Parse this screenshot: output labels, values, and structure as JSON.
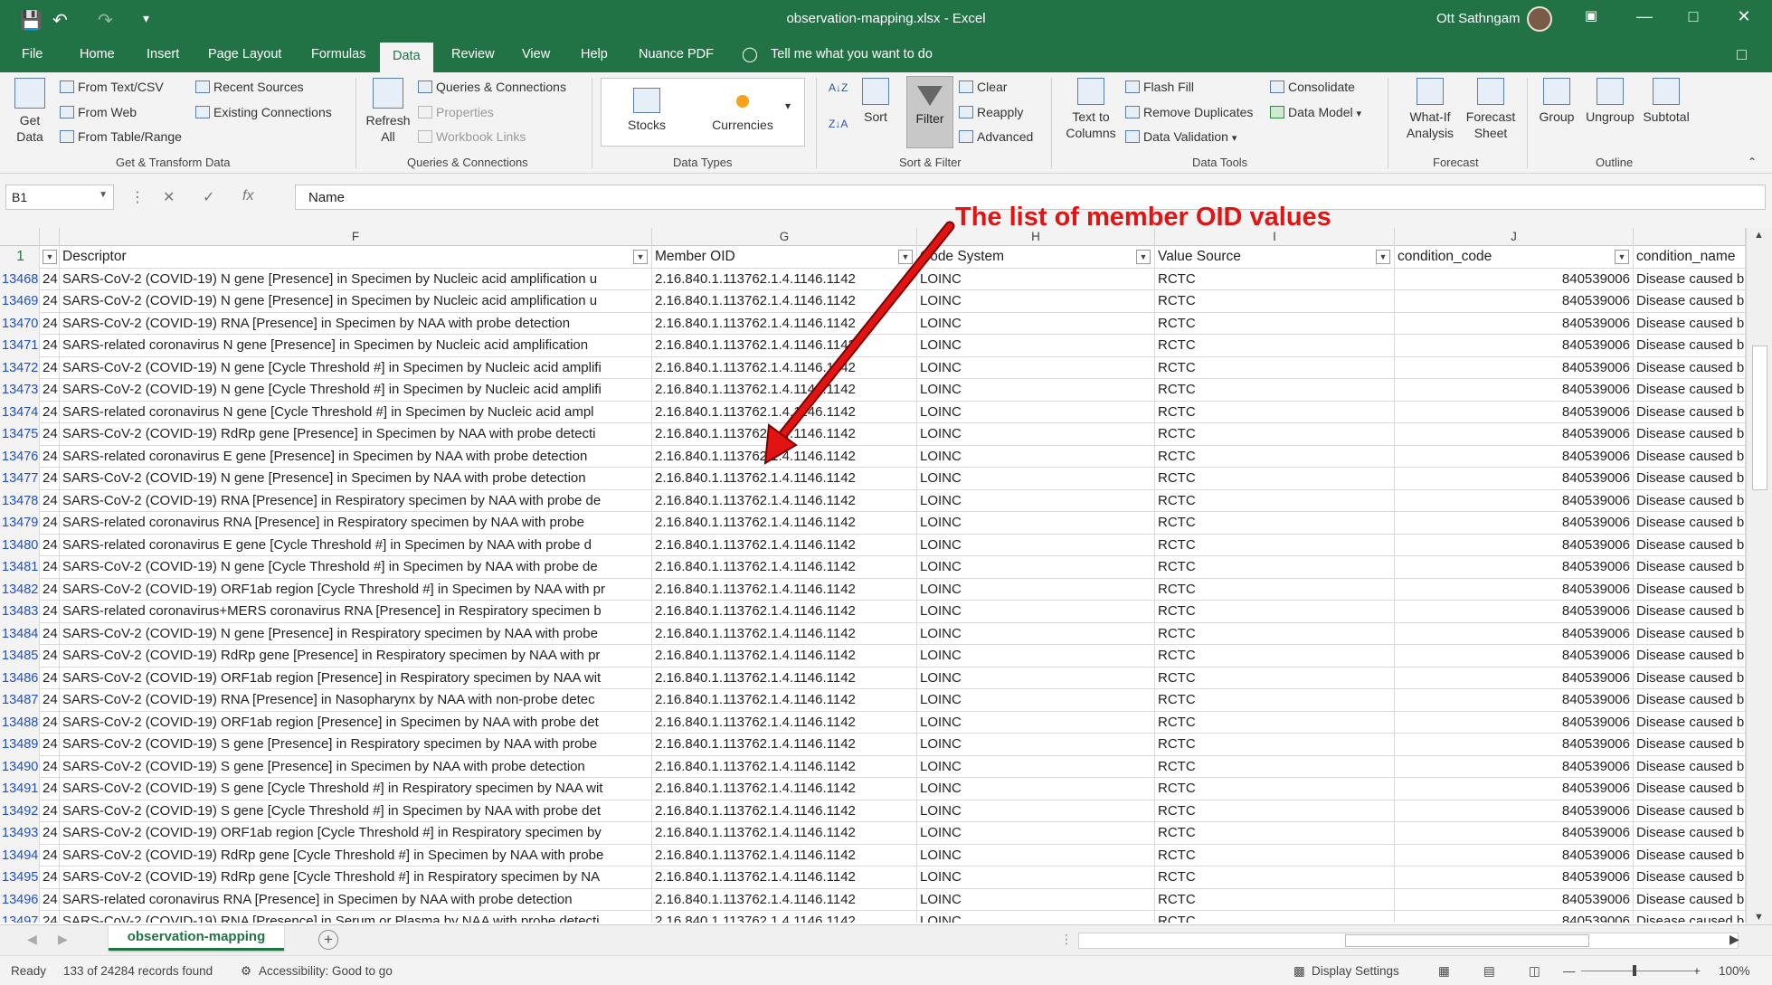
{
  "window": {
    "title": "observation-mapping.xlsx  -  Excel",
    "user": "Ott Sathngam"
  },
  "menu": {
    "tabs": [
      "File",
      "Home",
      "Insert",
      "Page Layout",
      "Formulas",
      "Data",
      "Review",
      "View",
      "Help",
      "Nuance PDF"
    ],
    "active": "Data",
    "tell_me": "Tell me what you want to do"
  },
  "ribbon": {
    "get_transform": {
      "get_data": "Get Data",
      "from_text": "From Text/CSV",
      "from_web": "From Web",
      "from_table": "From Table/Range",
      "recent_sources": "Recent Sources",
      "existing_connections": "Existing Connections",
      "label": "Get & Transform Data"
    },
    "queries": {
      "refresh_all": "Refresh All",
      "queries_connections": "Queries & Connections",
      "properties": "Properties",
      "workbook_links": "Workbook Links",
      "label": "Queries & Connections"
    },
    "data_types": {
      "stocks": "Stocks",
      "currencies": "Currencies",
      "label": "Data Types"
    },
    "sort_filter": {
      "sort": "Sort",
      "filter": "Filter",
      "clear": "Clear",
      "reapply": "Reapply",
      "advanced": "Advanced",
      "label": "Sort & Filter"
    },
    "data_tools": {
      "text_to_columns": "Text to Columns",
      "flash_fill": "Flash Fill",
      "remove_duplicates": "Remove Duplicates",
      "data_validation": "Data Validation",
      "consolidate": "Consolidate",
      "data_model": "Data Model",
      "label": "Data Tools"
    },
    "forecast": {
      "what_if": "What-If Analysis",
      "forecast_sheet": "Forecast Sheet",
      "label": "Forecast"
    },
    "outline": {
      "group": "Group",
      "ungroup": "Ungroup",
      "subtotal": "Subtotal",
      "label": "Outline"
    }
  },
  "formula_bar": {
    "name_box": "B1",
    "formula": "Name"
  },
  "grid": {
    "column_letters": [
      "F",
      "G",
      "H",
      "I",
      "J"
    ],
    "header_row_number": "1",
    "headers": [
      "Descriptor",
      "Member OID",
      "Code System",
      "Value Source",
      "condition_code",
      "condition_name"
    ],
    "rows": [
      [
        "13468",
        "24",
        "SARS-CoV-2 (COVID-19) N gene [Presence] in Specimen by Nucleic acid amplification u",
        "2.16.840.1.113762.1.4.1146.1142",
        "LOINC",
        "RCTC",
        "840539006",
        "Disease caused b"
      ],
      [
        "13469",
        "24",
        "SARS-CoV-2 (COVID-19) N gene [Presence] in Specimen by Nucleic acid amplification u",
        "2.16.840.1.113762.1.4.1146.1142",
        "LOINC",
        "RCTC",
        "840539006",
        "Disease caused b"
      ],
      [
        "13470",
        "24",
        "SARS-CoV-2 (COVID-19) RNA [Presence] in Specimen by NAA with probe detection",
        "2.16.840.1.113762.1.4.1146.1142",
        "LOINC",
        "RCTC",
        "840539006",
        "Disease caused b"
      ],
      [
        "13471",
        "24",
        "SARS-related coronavirus N gene [Presence] in Specimen by Nucleic acid amplification",
        "2.16.840.1.113762.1.4.1146.1142",
        "LOINC",
        "RCTC",
        "840539006",
        "Disease caused b"
      ],
      [
        "13472",
        "24",
        "SARS-CoV-2 (COVID-19) N gene [Cycle Threshold #] in Specimen by Nucleic acid amplifi",
        "2.16.840.1.113762.1.4.1146.1142",
        "LOINC",
        "RCTC",
        "840539006",
        "Disease caused b"
      ],
      [
        "13473",
        "24",
        "SARS-CoV-2 (COVID-19) N gene [Cycle Threshold #] in Specimen by Nucleic acid amplifi",
        "2.16.840.1.113762.1.4.1146.1142",
        "LOINC",
        "RCTC",
        "840539006",
        "Disease caused b"
      ],
      [
        "13474",
        "24",
        "SARS-related coronavirus N gene [Cycle Threshold #] in Specimen by Nucleic acid ampl",
        "2.16.840.1.113762.1.4.1146.1142",
        "LOINC",
        "RCTC",
        "840539006",
        "Disease caused b"
      ],
      [
        "13475",
        "24",
        "SARS-CoV-2 (COVID-19) RdRp gene [Presence] in Specimen by NAA with probe detecti",
        "2.16.840.1.113762.1.4.1146.1142",
        "LOINC",
        "RCTC",
        "840539006",
        "Disease caused b"
      ],
      [
        "13476",
        "24",
        "SARS-related coronavirus E gene [Presence] in Specimen by NAA with probe detection",
        "2.16.840.1.113762.1.4.1146.1142",
        "LOINC",
        "RCTC",
        "840539006",
        "Disease caused b"
      ],
      [
        "13477",
        "24",
        "SARS-CoV-2 (COVID-19) N gene [Presence] in Specimen by NAA with probe detection",
        "2.16.840.1.113762.1.4.1146.1142",
        "LOINC",
        "RCTC",
        "840539006",
        "Disease caused b"
      ],
      [
        "13478",
        "24",
        "SARS-CoV-2 (COVID-19) RNA [Presence] in Respiratory specimen by NAA with probe de",
        "2.16.840.1.113762.1.4.1146.1142",
        "LOINC",
        "RCTC",
        "840539006",
        "Disease caused b"
      ],
      [
        "13479",
        "24",
        "SARS-related coronavirus RNA [Presence] in Respiratory specimen by NAA with probe",
        "2.16.840.1.113762.1.4.1146.1142",
        "LOINC",
        "RCTC",
        "840539006",
        "Disease caused b"
      ],
      [
        "13480",
        "24",
        "SARS-related coronavirus E gene [Cycle Threshold #] in Specimen by NAA with probe d",
        "2.16.840.1.113762.1.4.1146.1142",
        "LOINC",
        "RCTC",
        "840539006",
        "Disease caused b"
      ],
      [
        "13481",
        "24",
        "SARS-CoV-2 (COVID-19) N gene [Cycle Threshold #] in Specimen by NAA with probe de",
        "2.16.840.1.113762.1.4.1146.1142",
        "LOINC",
        "RCTC",
        "840539006",
        "Disease caused b"
      ],
      [
        "13482",
        "24",
        "SARS-CoV-2 (COVID-19) ORF1ab region [Cycle Threshold #] in Specimen by NAA with pr",
        "2.16.840.1.113762.1.4.1146.1142",
        "LOINC",
        "RCTC",
        "840539006",
        "Disease caused b"
      ],
      [
        "13483",
        "24",
        "SARS-related coronavirus+MERS coronavirus RNA [Presence] in Respiratory specimen b",
        "2.16.840.1.113762.1.4.1146.1142",
        "LOINC",
        "RCTC",
        "840539006",
        "Disease caused b"
      ],
      [
        "13484",
        "24",
        "SARS-CoV-2 (COVID-19) N gene [Presence] in Respiratory specimen by NAA with probe",
        "2.16.840.1.113762.1.4.1146.1142",
        "LOINC",
        "RCTC",
        "840539006",
        "Disease caused b"
      ],
      [
        "13485",
        "24",
        "SARS-CoV-2 (COVID-19) RdRp gene [Presence] in Respiratory specimen by NAA with pr",
        "2.16.840.1.113762.1.4.1146.1142",
        "LOINC",
        "RCTC",
        "840539006",
        "Disease caused b"
      ],
      [
        "13486",
        "24",
        "SARS-CoV-2 (COVID-19) ORF1ab region [Presence] in Respiratory specimen by NAA wit",
        "2.16.840.1.113762.1.4.1146.1142",
        "LOINC",
        "RCTC",
        "840539006",
        "Disease caused b"
      ],
      [
        "13487",
        "24",
        "SARS-CoV-2 (COVID-19) RNA [Presence] in Nasopharynx by NAA with non-probe detec",
        "2.16.840.1.113762.1.4.1146.1142",
        "LOINC",
        "RCTC",
        "840539006",
        "Disease caused b"
      ],
      [
        "13488",
        "24",
        "SARS-CoV-2 (COVID-19) ORF1ab region [Presence] in Specimen by NAA with probe det",
        "2.16.840.1.113762.1.4.1146.1142",
        "LOINC",
        "RCTC",
        "840539006",
        "Disease caused b"
      ],
      [
        "13489",
        "24",
        "SARS-CoV-2 (COVID-19) S gene [Presence] in Respiratory specimen by NAA with probe",
        "2.16.840.1.113762.1.4.1146.1142",
        "LOINC",
        "RCTC",
        "840539006",
        "Disease caused b"
      ],
      [
        "13490",
        "24",
        "SARS-CoV-2 (COVID-19) S gene [Presence] in Specimen by NAA with probe detection",
        "2.16.840.1.113762.1.4.1146.1142",
        "LOINC",
        "RCTC",
        "840539006",
        "Disease caused b"
      ],
      [
        "13491",
        "24",
        "SARS-CoV-2 (COVID-19) S gene [Cycle Threshold #] in Respiratory specimen by NAA wit",
        "2.16.840.1.113762.1.4.1146.1142",
        "LOINC",
        "RCTC",
        "840539006",
        "Disease caused b"
      ],
      [
        "13492",
        "24",
        "SARS-CoV-2 (COVID-19) S gene [Cycle Threshold #] in Specimen by NAA with probe det",
        "2.16.840.1.113762.1.4.1146.1142",
        "LOINC",
        "RCTC",
        "840539006",
        "Disease caused b"
      ],
      [
        "13493",
        "24",
        "SARS-CoV-2 (COVID-19) ORF1ab region [Cycle Threshold #] in Respiratory specimen by",
        "2.16.840.1.113762.1.4.1146.1142",
        "LOINC",
        "RCTC",
        "840539006",
        "Disease caused b"
      ],
      [
        "13494",
        "24",
        "SARS-CoV-2 (COVID-19) RdRp gene [Cycle Threshold #] in Specimen by NAA with probe",
        "2.16.840.1.113762.1.4.1146.1142",
        "LOINC",
        "RCTC",
        "840539006",
        "Disease caused b"
      ],
      [
        "13495",
        "24",
        "SARS-CoV-2 (COVID-19) RdRp gene [Cycle Threshold #] in Respiratory specimen by NA",
        "2.16.840.1.113762.1.4.1146.1142",
        "LOINC",
        "RCTC",
        "840539006",
        "Disease caused b"
      ],
      [
        "13496",
        "24",
        "SARS-related coronavirus RNA [Presence] in Specimen by NAA with probe detection",
        "2.16.840.1.113762.1.4.1146.1142",
        "LOINC",
        "RCTC",
        "840539006",
        "Disease caused b"
      ],
      [
        "13497",
        "24",
        "SARS-CoV-2 (COVID-19) RNA [Presence] in Serum or Plasma by NAA with probe detecti",
        "2.16.840.1.113762.1.4.1146.1142",
        "LOINC",
        "RCTC",
        "840539006",
        "Disease caused b"
      ]
    ]
  },
  "annotation": {
    "text": "The list of member OID values",
    "color": "#e11313"
  },
  "sheets": {
    "active": "observation-mapping"
  },
  "status": {
    "ready": "Ready",
    "records": "133 of 24284 records found",
    "accessibility": "Accessibility: Good to go",
    "display_settings": "Display Settings",
    "zoom": "100%"
  },
  "colors": {
    "brand": "#217346",
    "row_number": "#1f4fc4"
  }
}
